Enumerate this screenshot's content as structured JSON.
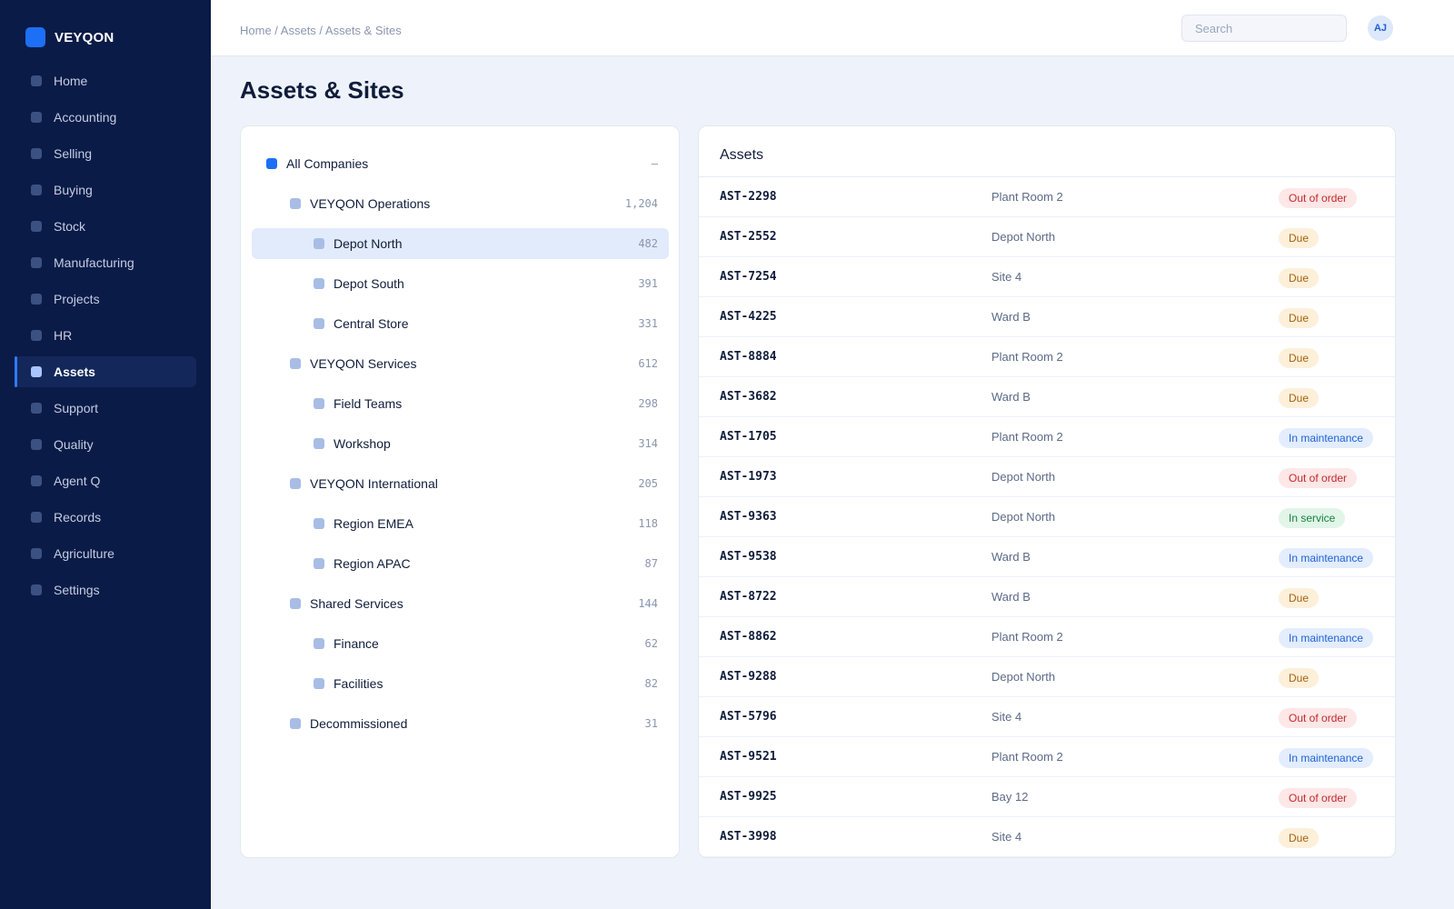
{
  "app": {
    "brand": "VEYQON"
  },
  "sidebar": {
    "items": [
      {
        "label": "Home"
      },
      {
        "label": "Accounting"
      },
      {
        "label": "Selling"
      },
      {
        "label": "Buying"
      },
      {
        "label": "Stock"
      },
      {
        "label": "Manufacturing"
      },
      {
        "label": "Projects"
      },
      {
        "label": "HR"
      },
      {
        "label": "Assets",
        "active": true
      },
      {
        "label": "Support"
      },
      {
        "label": "Quality"
      },
      {
        "label": "Agent Q"
      },
      {
        "label": "Records"
      },
      {
        "label": "Agriculture"
      },
      {
        "label": "Settings"
      }
    ]
  },
  "header": {
    "breadcrumb": "Home / Assets / Assets & Sites",
    "search_placeholder": "Search",
    "avatar_initials": "AJ"
  },
  "page": {
    "title": "Assets & Sites"
  },
  "tree": {
    "root": {
      "label": "All Companies",
      "count": "–"
    },
    "nodes": [
      {
        "label": "VEYQON Operations",
        "count": "1,204",
        "level": 1
      },
      {
        "label": "Depot North",
        "count": "482",
        "level": 2,
        "selected": true
      },
      {
        "label": "Depot South",
        "count": "391",
        "level": 2
      },
      {
        "label": "Central Store",
        "count": "331",
        "level": 2
      },
      {
        "label": "VEYQON Services",
        "count": "612",
        "level": 1
      },
      {
        "label": "Field Teams",
        "count": "298",
        "level": 2
      },
      {
        "label": "Workshop",
        "count": "314",
        "level": 2
      },
      {
        "label": "VEYQON International",
        "count": "205",
        "level": 1
      },
      {
        "label": "Region EMEA",
        "count": "118",
        "level": 2
      },
      {
        "label": "Region APAC",
        "count": "87",
        "level": 2
      },
      {
        "label": "Shared Services",
        "count": "144",
        "level": 1
      },
      {
        "label": "Finance",
        "count": "62",
        "level": 2
      },
      {
        "label": "Facilities",
        "count": "82",
        "level": 2
      },
      {
        "label": "Decommissioned",
        "count": "31",
        "level": 1
      }
    ]
  },
  "assets": {
    "title": "Assets",
    "rows": [
      {
        "id": "AST-2298",
        "location": "Plant Room 2",
        "status": "Out of order",
        "kind": "out"
      },
      {
        "id": "AST-2552",
        "location": "Depot North",
        "status": "Due",
        "kind": "due"
      },
      {
        "id": "AST-7254",
        "location": "Site 4",
        "status": "Due",
        "kind": "due"
      },
      {
        "id": "AST-4225",
        "location": "Ward B",
        "status": "Due",
        "kind": "due"
      },
      {
        "id": "AST-8884",
        "location": "Plant Room 2",
        "status": "Due",
        "kind": "due"
      },
      {
        "id": "AST-3682",
        "location": "Ward B",
        "status": "Due",
        "kind": "due"
      },
      {
        "id": "AST-1705",
        "location": "Plant Room 2",
        "status": "In maintenance",
        "kind": "maint"
      },
      {
        "id": "AST-1973",
        "location": "Depot North",
        "status": "Out of order",
        "kind": "out"
      },
      {
        "id": "AST-9363",
        "location": "Depot North",
        "status": "In service",
        "kind": "service"
      },
      {
        "id": "AST-9538",
        "location": "Ward B",
        "status": "In maintenance",
        "kind": "maint"
      },
      {
        "id": "AST-8722",
        "location": "Ward B",
        "status": "Due",
        "kind": "due"
      },
      {
        "id": "AST-8862",
        "location": "Plant Room 2",
        "status": "In maintenance",
        "kind": "maint"
      },
      {
        "id": "AST-9288",
        "location": "Depot North",
        "status": "Due",
        "kind": "due"
      },
      {
        "id": "AST-5796",
        "location": "Site 4",
        "status": "Out of order",
        "kind": "out"
      },
      {
        "id": "AST-9521",
        "location": "Plant Room 2",
        "status": "In maintenance",
        "kind": "maint"
      },
      {
        "id": "AST-9925",
        "location": "Bay 12",
        "status": "Out of order",
        "kind": "out"
      },
      {
        "id": "AST-3998",
        "location": "Site 4",
        "status": "Due",
        "kind": "due"
      }
    ]
  }
}
